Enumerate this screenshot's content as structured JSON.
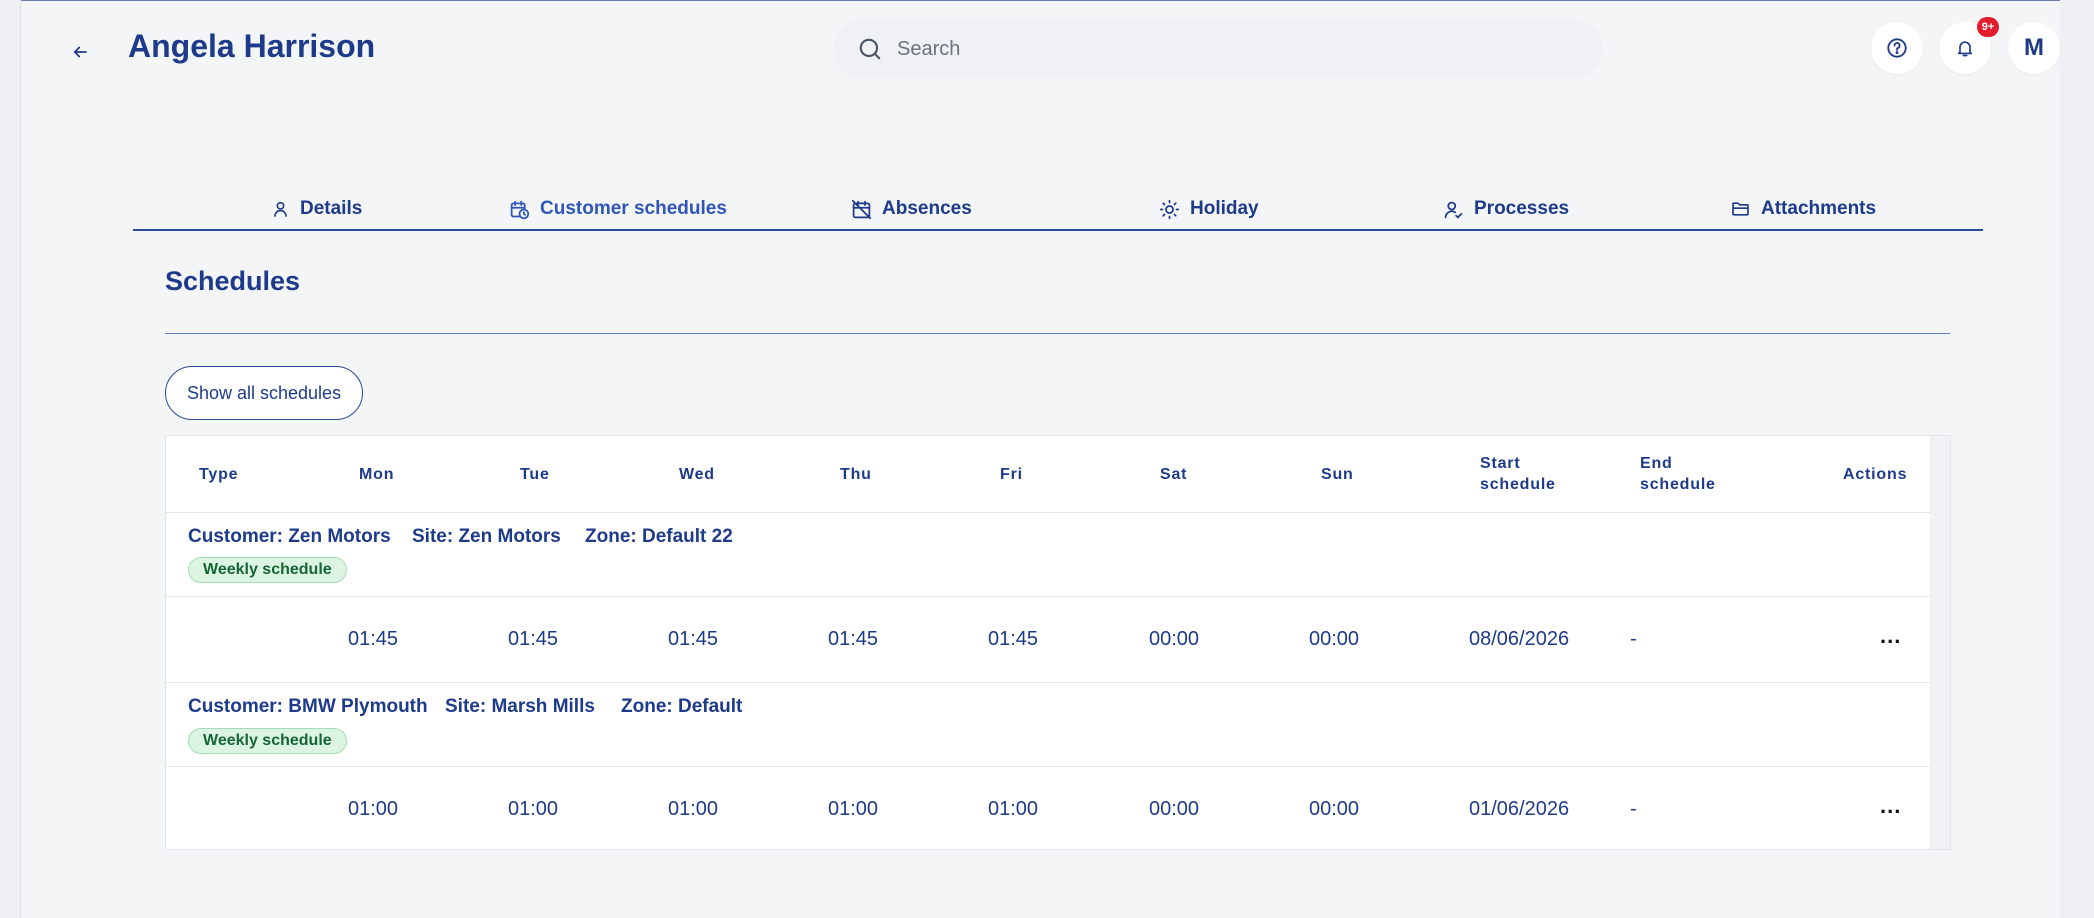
{
  "header": {
    "title": "Angela Harrison",
    "search_placeholder": "Search",
    "notification_badge": "9+",
    "avatar_initial": "M"
  },
  "tabs": [
    {
      "label": "Details",
      "icon": "user-icon"
    },
    {
      "label": "Customer schedules",
      "icon": "calendar-clock-icon"
    },
    {
      "label": "Absences",
      "icon": "calendar-off-icon"
    },
    {
      "label": "Holiday",
      "icon": "sun-icon"
    },
    {
      "label": "Processes",
      "icon": "user-check-icon"
    },
    {
      "label": "Attachments",
      "icon": "folder-icon"
    }
  ],
  "active_tab": "Customer schedules",
  "section": {
    "title": "Schedules",
    "show_all_label": "Show all schedules"
  },
  "table": {
    "headers": {
      "type": "Type",
      "mon": "Mon",
      "tue": "Tue",
      "wed": "Wed",
      "thu": "Thu",
      "fri": "Fri",
      "sat": "Sat",
      "sun": "Sun",
      "start1": "Start",
      "start2": "schedule",
      "end1": "End",
      "end2": "schedule",
      "actions": "Actions"
    },
    "groups": [
      {
        "customer": "Customer: Zen Motors",
        "site": "Site: Zen Motors",
        "zone": "Zone: Default 22",
        "tag": "Weekly schedule",
        "mon": "01:45",
        "tue": "01:45",
        "wed": "01:45",
        "thu": "01:45",
        "fri": "01:45",
        "sat": "00:00",
        "sun": "00:00",
        "start": "08/06/2026",
        "end": "-",
        "actions": "..."
      },
      {
        "customer": "Customer: BMW Plymouth",
        "site": "Site: Marsh Mills",
        "zone": "Zone: Default",
        "tag": "Weekly schedule",
        "mon": "01:00",
        "tue": "01:00",
        "wed": "01:00",
        "thu": "01:00",
        "fri": "01:00",
        "sat": "00:00",
        "sun": "00:00",
        "start": "01/06/2026",
        "end": "-",
        "actions": "..."
      }
    ]
  },
  "colors": {
    "primary": "#1e3a8a",
    "accent": "#2f55b8",
    "badge": "#e11d2e",
    "tag_bg": "#dcf5e3",
    "tag_text": "#166534"
  }
}
